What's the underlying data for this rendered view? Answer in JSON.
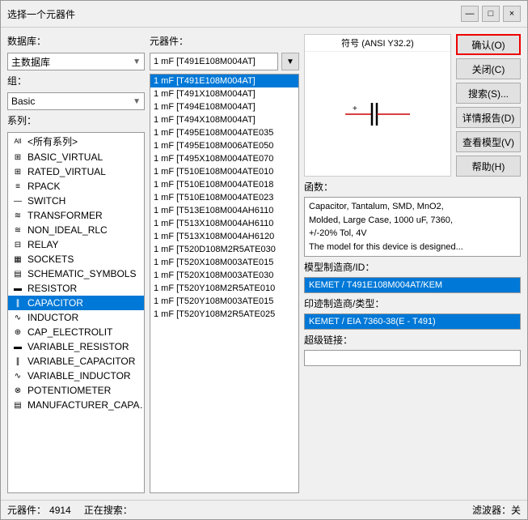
{
  "window": {
    "title": "选择一个元器件",
    "min_label": "—",
    "max_label": "□",
    "close_label": "×"
  },
  "left_panel": {
    "db_label": "数据库：",
    "db_value": "主数据库",
    "group_label": "组：",
    "group_value": "Basic",
    "series_label": "系列：",
    "series_items": [
      {
        "icon": "all",
        "label": "<所有系列>",
        "selected": false
      },
      {
        "icon": "basic",
        "label": "BASIC_VIRTUAL",
        "selected": false
      },
      {
        "icon": "rated",
        "label": "RATED_VIRTUAL",
        "selected": false
      },
      {
        "icon": "rpack",
        "label": "RPACK",
        "selected": false
      },
      {
        "icon": "switch",
        "label": "SWITCH",
        "selected": false
      },
      {
        "icon": "transformer",
        "label": "TRANSFORMER",
        "selected": false
      },
      {
        "icon": "nonideal",
        "label": "NON_IDEAL_RLC",
        "selected": false
      },
      {
        "icon": "relay",
        "label": "RELAY",
        "selected": false
      },
      {
        "icon": "sockets",
        "label": "SOCKETS",
        "selected": false
      },
      {
        "icon": "schematic",
        "label": "SCHEMATIC_SYMBOLS",
        "selected": false
      },
      {
        "icon": "resistor",
        "label": "RESISTOR",
        "selected": false
      },
      {
        "icon": "capacitor",
        "label": "CAPACITOR",
        "selected": true
      },
      {
        "icon": "inductor",
        "label": "INDUCTOR",
        "selected": false
      },
      {
        "icon": "cap_elec",
        "label": "CAP_ELECTROLIT",
        "selected": false
      },
      {
        "icon": "var_res",
        "label": "VARIABLE_RESISTOR",
        "selected": false
      },
      {
        "icon": "var_cap",
        "label": "VARIABLE_CAPACITOR",
        "selected": false
      },
      {
        "icon": "var_ind",
        "label": "VARIABLE_INDUCTOR",
        "selected": false
      },
      {
        "icon": "pot",
        "label": "POTENTIOMETER",
        "selected": false
      },
      {
        "icon": "mfr",
        "label": "MANUFACTURER_CAPA…",
        "selected": false
      }
    ]
  },
  "middle_panel": {
    "label": "元器件：",
    "search_value": "1 mF  [T491E108M004AT]",
    "filter_icon": "▼",
    "components": [
      {
        "label": "1 mF  [T491E108M004AT]",
        "selected": true
      },
      {
        "label": "1 mF  [T491X108M004AT]",
        "selected": false
      },
      {
        "label": "1 mF  [T494E108M004AT]",
        "selected": false
      },
      {
        "label": "1 mF  [T494X108M004AT]",
        "selected": false
      },
      {
        "label": "1 mF  [T495E108M004ATE035",
        "selected": false
      },
      {
        "label": "1 mF  [T495E108M006ATE050",
        "selected": false
      },
      {
        "label": "1 mF  [T495X108M004ATE070",
        "selected": false
      },
      {
        "label": "1 mF  [T510E108M004ATE010",
        "selected": false
      },
      {
        "label": "1 mF  [T510E108M004ATE018",
        "selected": false
      },
      {
        "label": "1 mF  [T510E108M004ATE023",
        "selected": false
      },
      {
        "label": "1 mF  [T513E108M004AH6110",
        "selected": false
      },
      {
        "label": "1 mF  [T513X108M004AH6110",
        "selected": false
      },
      {
        "label": "1 mF  [T513X108M004AH6120",
        "selected": false
      },
      {
        "label": "1 mF  [T520D108M2R5ATE030",
        "selected": false
      },
      {
        "label": "1 mF  [T520X108M003ATE015",
        "selected": false
      },
      {
        "label": "1 mF  [T520X108M003ATE030",
        "selected": false
      },
      {
        "label": "1 mF  [T520Y108M2R5ATE010",
        "selected": false
      },
      {
        "label": "1 mF  [T520Y108M003ATE015",
        "selected": false
      },
      {
        "label": "1 mF  [T520Y108M2R5ATE025",
        "selected": false
      }
    ]
  },
  "symbol_panel": {
    "label": "符号 (ANSI Y32.2)"
  },
  "action_buttons": [
    {
      "label": "确认(O)",
      "primary": true,
      "name": "confirm-button"
    },
    {
      "label": "关闭(C)",
      "primary": false,
      "name": "close-button"
    },
    {
      "label": "搜索(S)...",
      "primary": false,
      "name": "search-button"
    },
    {
      "label": "详情报告(D)",
      "primary": false,
      "name": "detail-report-button"
    },
    {
      "label": "查看模型(V)",
      "primary": false,
      "name": "view-model-button"
    },
    {
      "label": "帮助(H)",
      "primary": false,
      "name": "help-button"
    }
  ],
  "info": {
    "func_label": "函数：",
    "func_text": "Capacitor, Tantalum, SMD, MnO2,\nMolded, Large Case, 1000 uF, 7360,\n+/-20% Tol, 4V",
    "func_extra": "The model for this device is designed...",
    "model_label": "模型制造商/ID：",
    "model_value": "KEMET / T491E108M004AT/KEM",
    "footprint_label": "印迹制造商/类型：",
    "footprint_value": "KEMET / EIA 7360-38(E - T491)",
    "hyperlink_label": "超级链接："
  },
  "status_bar": {
    "components_label": "元器件：",
    "components_count": "4914",
    "searching_label": "正在搜索：",
    "searching_value": "",
    "filter_label": "滤波器：关"
  }
}
